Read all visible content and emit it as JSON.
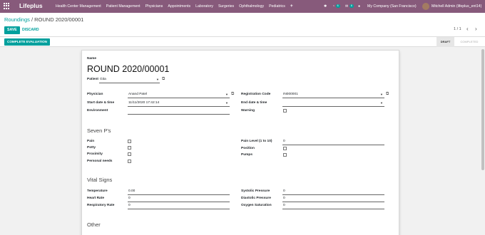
{
  "navbar": {
    "brand": "Lifeplus",
    "menu": [
      "Health Center Management",
      "Patient Management",
      "Physicians",
      "Appointments",
      "Laboratory",
      "Surgeries",
      "Ophthalmology",
      "Pediatrics"
    ],
    "add": "+",
    "activity_count": "6",
    "chat_count": "8",
    "company": "My Company (San Francisco)",
    "user": "Mitchell Admin (lifeplus_ent14)"
  },
  "breadcrumb": {
    "parent": "Roundings",
    "separator": " / ",
    "current": "ROUND 2020/00001"
  },
  "buttons": {
    "save": "SAVE",
    "discard": "DISCARD",
    "complete_evaluation": "COMPLETE EVALUATION"
  },
  "pager": {
    "text": "1 / 1",
    "prev": "‹",
    "next": "›"
  },
  "statusbar": {
    "draft": "DRAFT",
    "completed": "COMPLETED"
  },
  "form": {
    "name_label": "Name",
    "name": "ROUND 2020/00001",
    "patient_label": "Patient",
    "patient": "Gita",
    "physician_label": "Physician",
    "physician": "Anand Patel",
    "start_label": "Start date & time",
    "start": "11/11/2020 17:42:14",
    "environment_label": "Environment",
    "regcode_label": "Registration Code",
    "regcode": "IN000001",
    "end_label": "End date & time",
    "warning_label": "Warning",
    "seven_title": "Seven P's",
    "pain_label": "Pain",
    "potty_label": "Potty",
    "proximity_label": "Proximity",
    "personal_label": "Personal needs",
    "painlevel_label": "Pain Level (1 to 10)",
    "painlevel": "0",
    "position_label": "Position",
    "pumps_label": "Pumps",
    "vital_title": "Vital Signs",
    "temp_label": "Temperature",
    "temp": "0.00",
    "hr_label": "Heart Rate",
    "hr": "0",
    "rr_label": "Respiratory Rate",
    "rr": "0",
    "sys_label": "Systolic Pressure",
    "sys": "0",
    "dia_label": "Diastolic Pressure",
    "dia": "0",
    "o2_label": "Oxygen Saturation",
    "o2": "0",
    "other_title": "Other"
  },
  "colors": {
    "brand": "#875a7b",
    "accent": "#00a09d"
  }
}
